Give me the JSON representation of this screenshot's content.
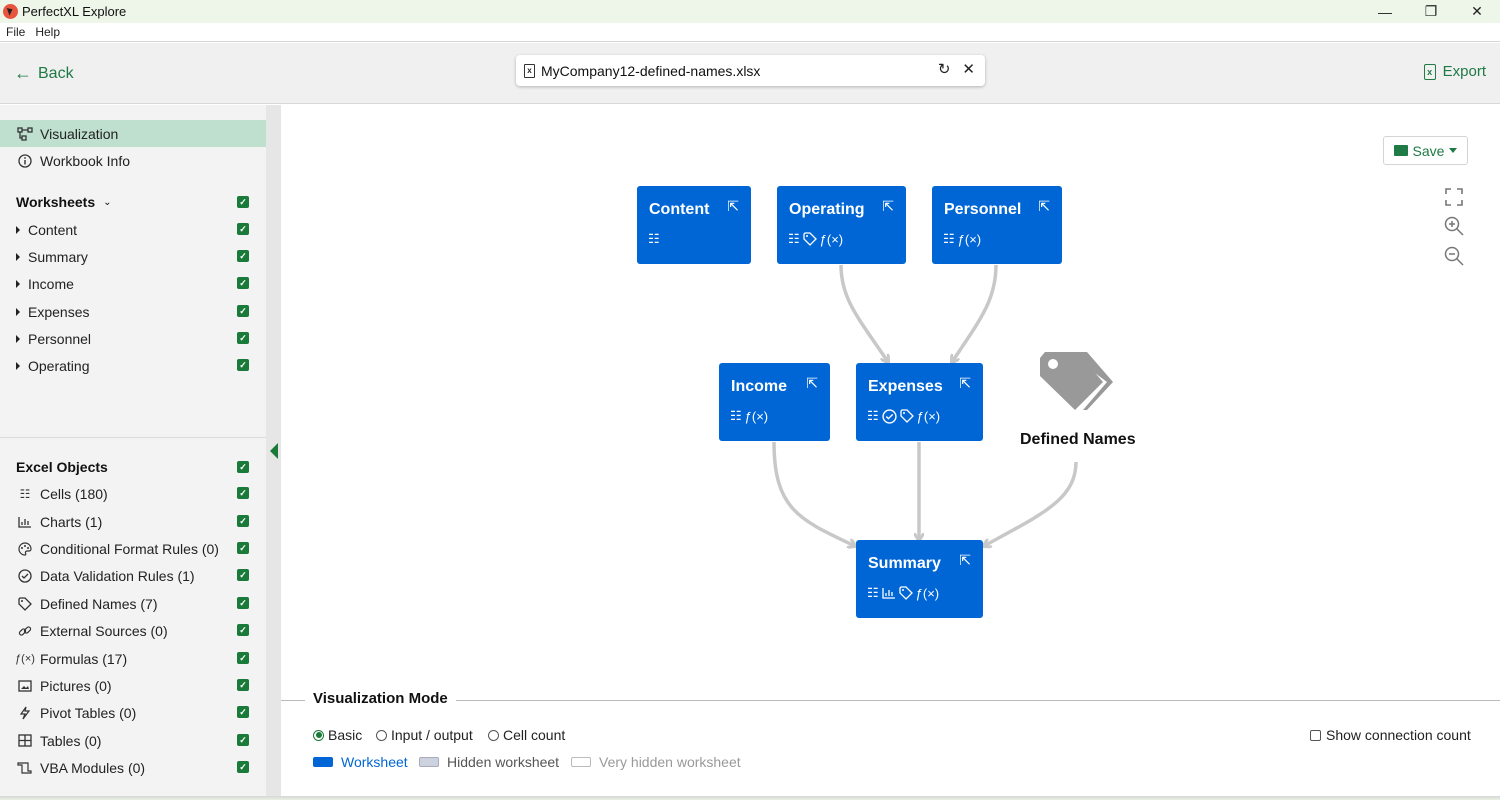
{
  "window": {
    "title": "PerfectXL Explore",
    "controls": {
      "minimize": "—",
      "maximize": "❐",
      "close": "✕"
    }
  },
  "menu": {
    "items": [
      "File",
      "Help"
    ]
  },
  "header": {
    "back_label": "Back",
    "file_name": "MyCompany12-defined-names.xlsx",
    "reload_icon": "↻",
    "close_icon": "✕",
    "export_label": "Export"
  },
  "sidebar": {
    "nav": [
      {
        "label": "Visualization",
        "icon": "diagram-icon",
        "active": true
      },
      {
        "label": "Workbook Info",
        "icon": "info-icon",
        "active": false
      }
    ],
    "worksheets_title": "Worksheets",
    "worksheets": [
      {
        "label": "Content",
        "checked": true
      },
      {
        "label": "Summary",
        "checked": true
      },
      {
        "label": "Income",
        "checked": true
      },
      {
        "label": "Expenses",
        "checked": true
      },
      {
        "label": "Personnel",
        "checked": true
      },
      {
        "label": "Operating",
        "checked": true
      }
    ],
    "objects_title": "Excel Objects",
    "objects": [
      {
        "label": "Cells (180)",
        "icon": "cells-icon",
        "glyph": "☷",
        "checked": true
      },
      {
        "label": "Charts (1)",
        "icon": "chart-icon",
        "glyph": "📊",
        "checked": true
      },
      {
        "label": "Conditional Format Rules (0)",
        "icon": "palette-icon",
        "glyph": "🎨",
        "checked": true
      },
      {
        "label": "Data Validation Rules (1)",
        "icon": "check-circle-icon",
        "glyph": "✓",
        "checked": true
      },
      {
        "label": "Defined Names (7)",
        "icon": "tag-icon",
        "glyph": "⬡",
        "checked": true
      },
      {
        "label": "External Sources (0)",
        "icon": "link-icon",
        "glyph": "🔗",
        "checked": true
      },
      {
        "label": "Formulas (17)",
        "icon": "function-icon",
        "glyph": "f(x)",
        "checked": true
      },
      {
        "label": "Pictures (0)",
        "icon": "picture-icon",
        "glyph": "▣",
        "checked": true
      },
      {
        "label": "Pivot Tables (0)",
        "icon": "bolt-icon",
        "glyph": "ϟ",
        "checked": true
      },
      {
        "label": "Tables (0)",
        "icon": "table-icon",
        "glyph": "⊞",
        "checked": true
      },
      {
        "label": "VBA Modules (0)",
        "icon": "scroll-icon",
        "glyph": "⎘",
        "checked": true
      }
    ]
  },
  "canvas": {
    "save_label": "Save",
    "tools": [
      "fullscreen-icon",
      "zoom-in-icon",
      "zoom-out-icon"
    ],
    "nodes": [
      {
        "id": "content",
        "label": "Content",
        "icons": [
          "cells"
        ]
      },
      {
        "id": "operating",
        "label": "Operating",
        "icons": [
          "cells",
          "tag",
          "formula"
        ]
      },
      {
        "id": "personnel",
        "label": "Personnel",
        "icons": [
          "cells",
          "formula"
        ]
      },
      {
        "id": "income",
        "label": "Income",
        "icons": [
          "cells",
          "formula"
        ]
      },
      {
        "id": "expenses",
        "label": "Expenses",
        "icons": [
          "cells",
          "validation",
          "tag",
          "formula"
        ]
      },
      {
        "id": "summary",
        "label": "Summary",
        "icons": [
          "cells",
          "chart",
          "tag",
          "formula"
        ]
      }
    ],
    "defined_names_label": "Defined Names",
    "edges": [
      {
        "from": "operating",
        "to": "expenses"
      },
      {
        "from": "personnel",
        "to": "expenses"
      },
      {
        "from": "income",
        "to": "summary"
      },
      {
        "from": "expenses",
        "to": "summary"
      },
      {
        "from": "defined-names",
        "to": "summary"
      }
    ],
    "colors": {
      "node": "#0066d6",
      "edge": "#c8c8c8",
      "accent": "#1a7a3a"
    }
  },
  "mode": {
    "title": "Visualization Mode",
    "options": [
      {
        "label": "Basic",
        "selected": true
      },
      {
        "label": "Input / output",
        "selected": false
      },
      {
        "label": "Cell count",
        "selected": false
      }
    ],
    "legend": [
      {
        "label": "Worksheet",
        "color": "#0066d6"
      },
      {
        "label": "Hidden worksheet",
        "color": "#ccd3de"
      },
      {
        "label": "Very hidden worksheet",
        "color": "#ffffff"
      }
    ],
    "show_connection_count_label": "Show connection count",
    "show_connection_count": false
  }
}
